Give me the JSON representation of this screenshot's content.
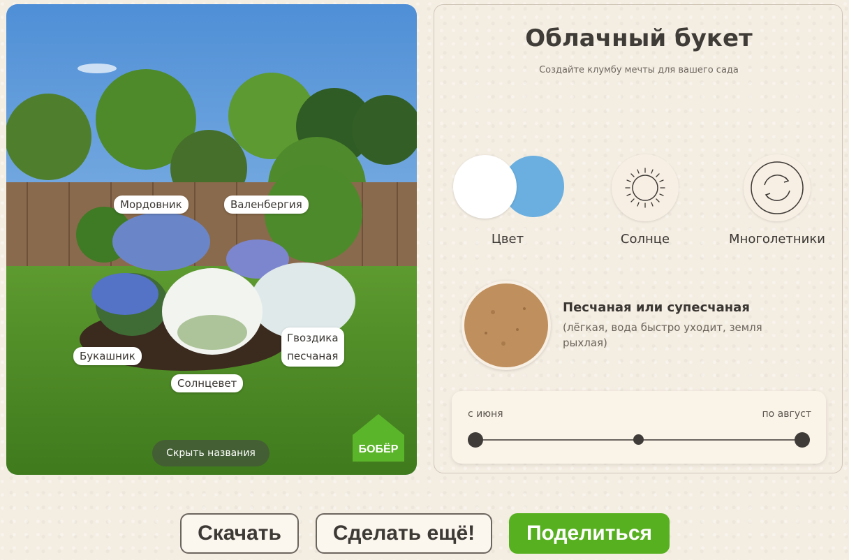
{
  "garden": {
    "plant_labels": [
      "Мордовник",
      "Валенбергия",
      "Букашник",
      "Гвоздика\nпесчаная",
      "Солнцевет"
    ],
    "hide_names_label": "Скрыть названия",
    "logo_text": "БОБЁР"
  },
  "panel": {
    "title": "Облачный букет",
    "subtitle": "Создайте клумбу мечты для вашего сада",
    "features": [
      {
        "label": "Цвет",
        "icon": "color-swatch-icon",
        "colors": [
          "#ffffff",
          "#6aafe0"
        ]
      },
      {
        "label": "Солнце",
        "icon": "sun-icon"
      },
      {
        "label": "Многолетники",
        "icon": "perennial-cycle-icon"
      }
    ],
    "soil": {
      "title": "Песчаная или супесчаная",
      "description": "(лёгкая, вода быстро уходит, земля рыхлая)",
      "icon": "sandy-soil-icon"
    },
    "season": {
      "from": "с июня",
      "to": "по август"
    }
  },
  "actions": {
    "download": "Скачать",
    "again": "Сделать ещё!",
    "share": "Поделиться"
  },
  "colors": {
    "accent_green": "#57b01f"
  }
}
